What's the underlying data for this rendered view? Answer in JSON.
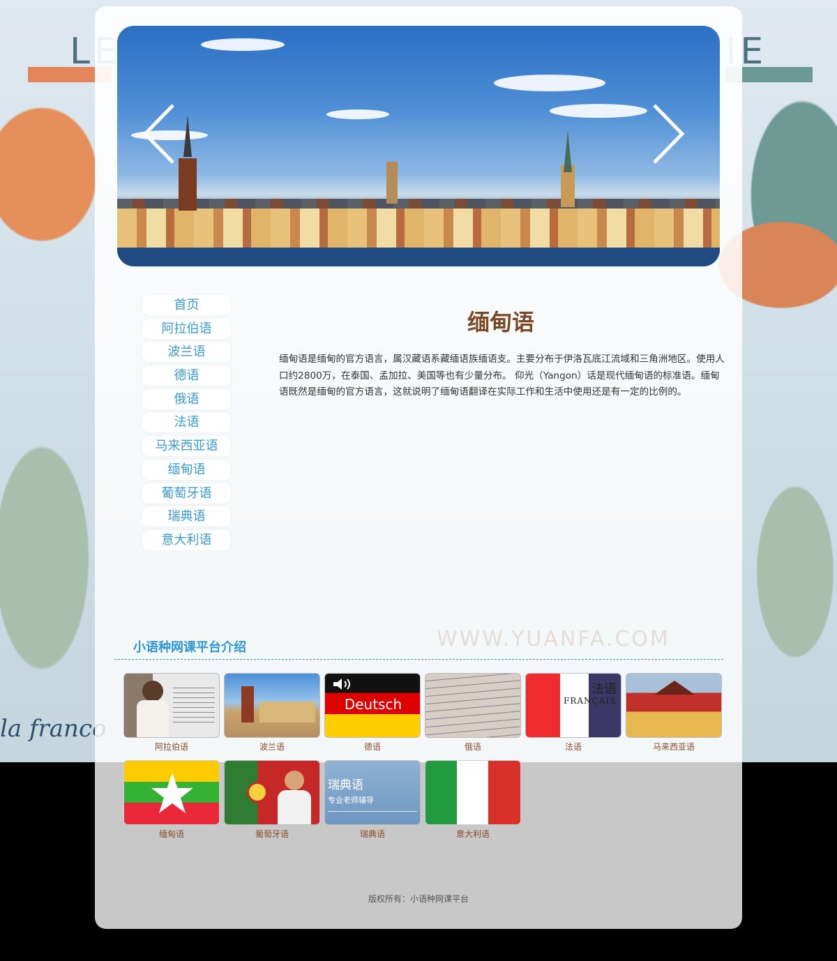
{
  "background": {
    "left_title": "LE",
    "right_title": "IE",
    "watermark": "WWW.YUANFA.COM",
    "franco_text": "la franco"
  },
  "banner": {
    "prev_icon": "chevron-left-icon",
    "next_icon": "chevron-right-icon"
  },
  "nav": {
    "items": [
      {
        "label": "首页"
      },
      {
        "label": "阿拉伯语"
      },
      {
        "label": "波兰语"
      },
      {
        "label": "德语"
      },
      {
        "label": "俄语"
      },
      {
        "label": "法语"
      },
      {
        "label": "马来西亚语"
      },
      {
        "label": "缅甸语"
      },
      {
        "label": "葡萄牙语"
      },
      {
        "label": "瑞典语"
      },
      {
        "label": "意大利语"
      }
    ]
  },
  "article": {
    "title": "缅甸语",
    "body": "缅甸语是缅甸的官方语言，属汉藏语系藏缅语族缅语支。主要分布于伊洛瓦底江流域和三角洲地区。使用人口约2800万，在泰国、孟加拉、美国等也有少量分布。 仰光（Yangon）话是现代缅甸语的标准语。缅甸语既然是缅甸的官方语言，这就说明了缅甸语翻译在实际工作和生活中使用还是有一定的比例的。"
  },
  "section": {
    "heading": "小语种网课平台介绍"
  },
  "gallery": {
    "items": [
      {
        "caption": "阿拉伯语"
      },
      {
        "caption": "波兰语"
      },
      {
        "caption": "德语",
        "image_text": "Deutsch"
      },
      {
        "caption": "俄语"
      },
      {
        "caption": "法语",
        "image_text": "法语",
        "image_text2": "FRANÇAIS"
      },
      {
        "caption": "马来西亚语"
      },
      {
        "caption": "缅甸语"
      },
      {
        "caption": "葡萄牙语"
      },
      {
        "caption": "瑞典语",
        "image_text": "瑞典语",
        "image_text2": "专业老师辅导"
      },
      {
        "caption": "意大利语"
      }
    ]
  },
  "footer": {
    "copyright": "版权所有：小语种网课平台"
  },
  "colors": {
    "nav_text": "#3a9bd0",
    "title": "#7a4a27",
    "heading": "#2f97cf",
    "caption": "#8b4b2a"
  }
}
